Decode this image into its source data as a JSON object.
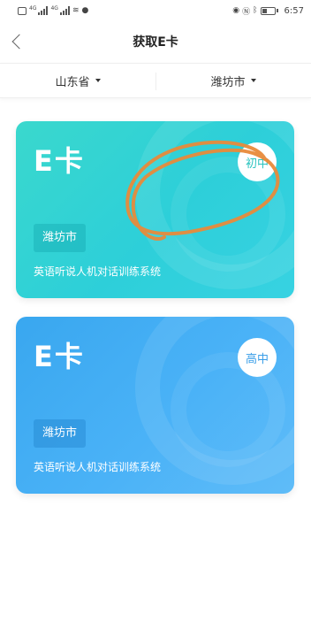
{
  "status_bar": {
    "net_1": "4G",
    "net_2": "4G",
    "time": "6:57"
  },
  "nav": {
    "title": "获取E卡"
  },
  "filters": {
    "province": "山东省",
    "city": "潍坊市"
  },
  "cards": [
    {
      "name": "E卡",
      "level": "初中",
      "city": "潍坊市",
      "system": "英语听说人机对话训练系统"
    },
    {
      "name": "E卡",
      "level": "高中",
      "city": "潍坊市",
      "system": "英语听说人机对话训练系统"
    }
  ],
  "colors": {
    "teal_card": "#33d4d4",
    "blue_card": "#48b0f5",
    "annotation": "#e88a3a"
  }
}
